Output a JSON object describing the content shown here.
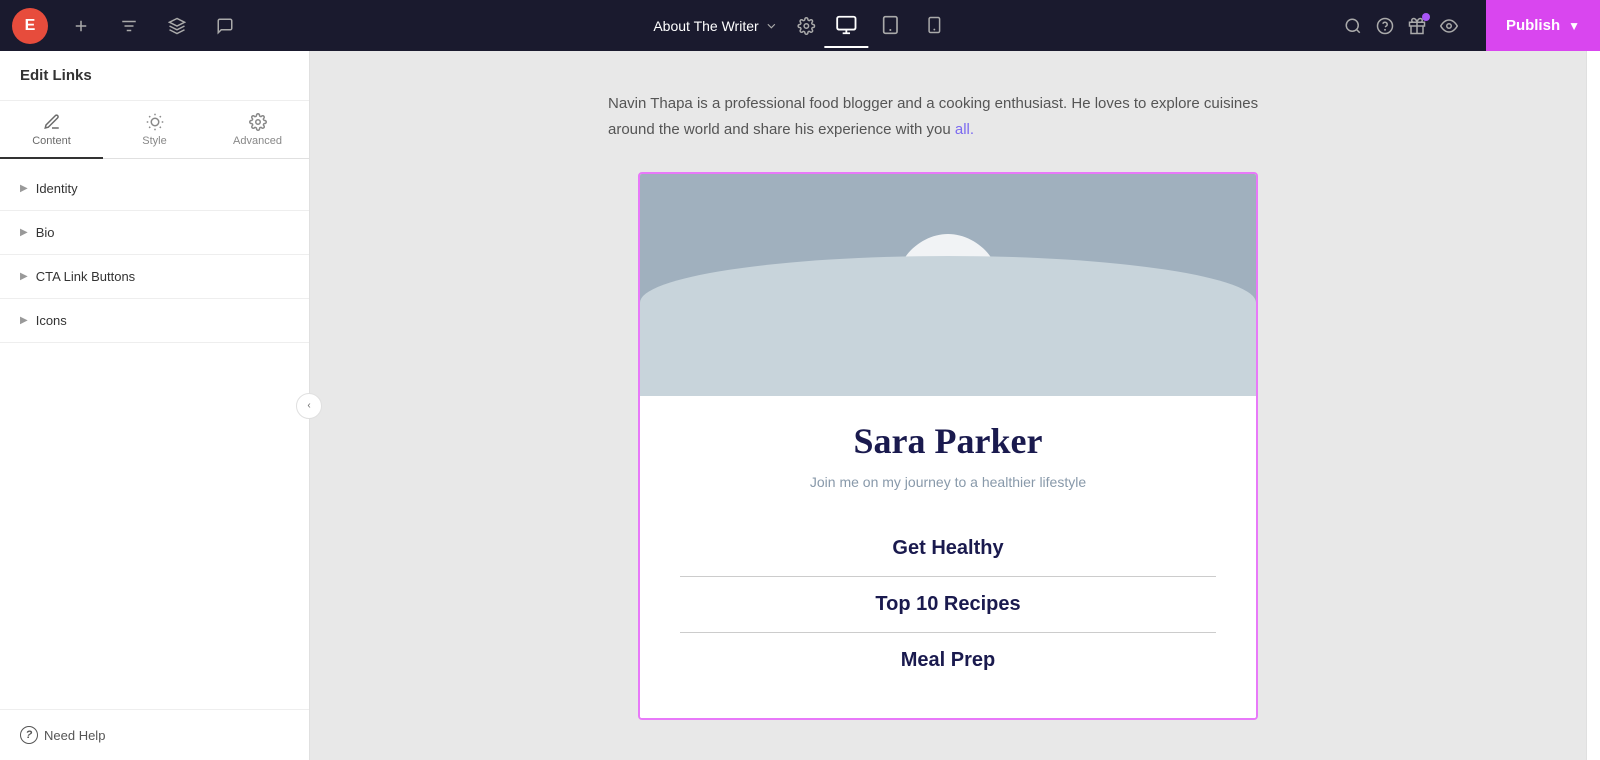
{
  "topbar": {
    "logo_text": "E",
    "page_title": "About The Writer",
    "publish_label": "Publish",
    "tabs": {
      "content_label": "Content",
      "style_label": "Style",
      "advanced_label": "Advanced"
    }
  },
  "sidebar": {
    "header": "Edit Links",
    "tabs": [
      {
        "id": "content",
        "label": "Content",
        "active": true
      },
      {
        "id": "style",
        "label": "Style",
        "active": false
      },
      {
        "id": "advanced",
        "label": "Advanced",
        "active": false
      }
    ],
    "sections": [
      {
        "id": "identity",
        "label": "Identity"
      },
      {
        "id": "bio",
        "label": "Bio"
      },
      {
        "id": "cta-link-buttons",
        "label": "CTA Link Buttons"
      },
      {
        "id": "icons",
        "label": "Icons"
      }
    ],
    "footer": {
      "need_help": "Need Help"
    }
  },
  "canvas": {
    "bio_text": "Navin Thapa is a professional food blogger and a cooking enthusiast. He loves to explore cuisines around the world and share his experience with you all.",
    "bio_link_text": "all.",
    "card": {
      "name": "Sara Parker",
      "tagline": "Join me on my journey to a healthier lifestyle",
      "menu_items": [
        "Get Healthy",
        "Top 10 Recipes",
        "Meal Prep"
      ]
    }
  }
}
